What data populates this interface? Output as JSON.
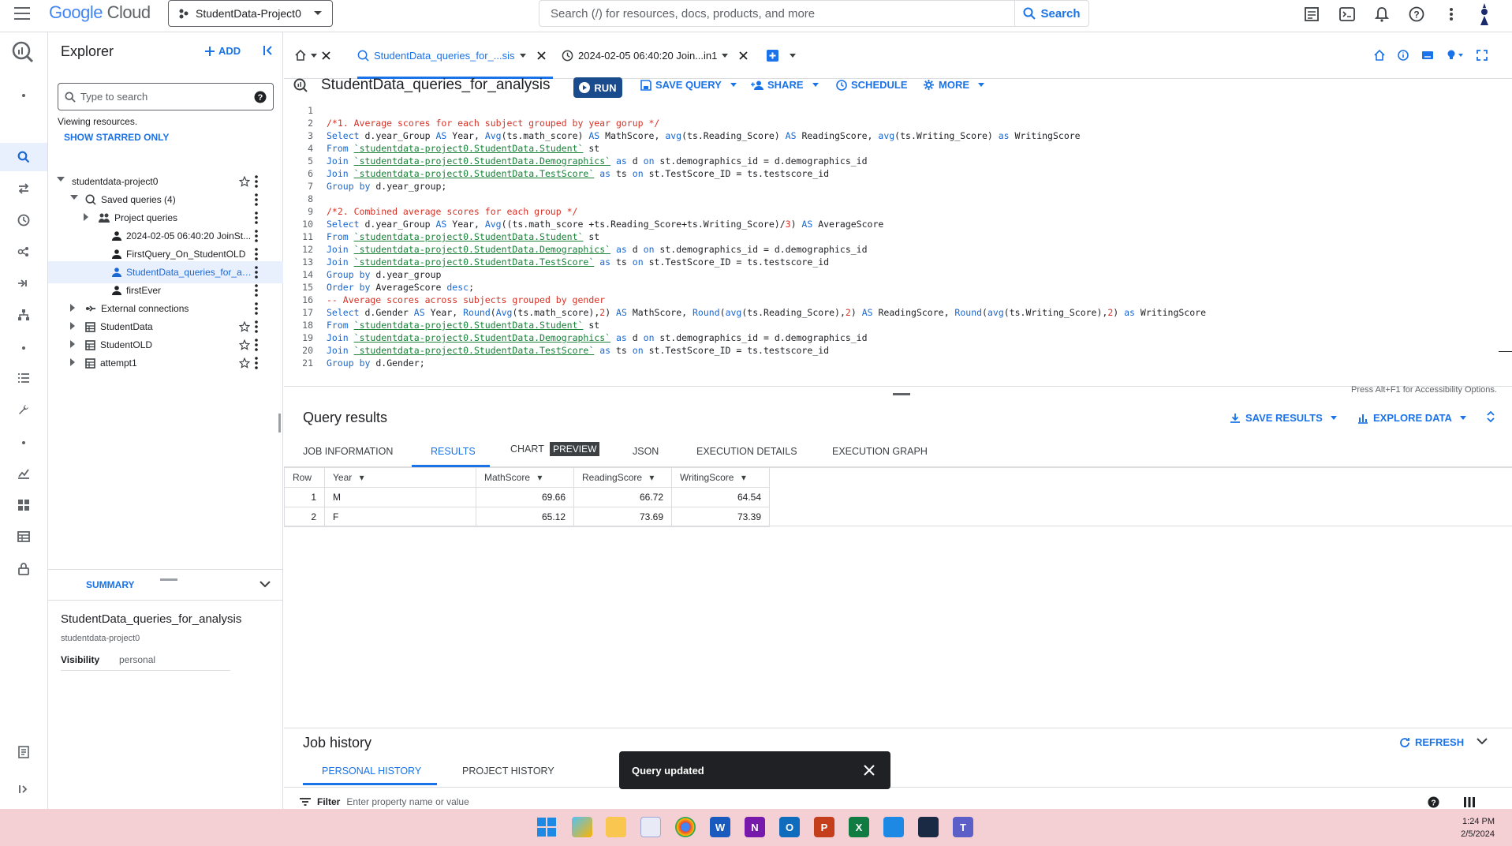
{
  "topbar": {
    "logo_google": "Google",
    "logo_cloud": "Cloud",
    "project": "StudentData-Project0",
    "search_placeholder": "Search (/) for resources, docs, products, and more",
    "search_button": "Search"
  },
  "explorer": {
    "title": "Explorer",
    "add_label": "ADD",
    "search_placeholder": "Type to search",
    "viewing": "Viewing resources.",
    "show_starred": "SHOW STARRED ONLY",
    "tree": [
      {
        "label": "studentdata-project0",
        "indent": 0,
        "expanded": true,
        "icon": "none",
        "star": true
      },
      {
        "label": "Saved queries (4)",
        "indent": 1,
        "expanded": true,
        "icon": "saved-query-icon",
        "star": false
      },
      {
        "label": "Project queries",
        "indent": 2,
        "expanded": false,
        "icon": "people-icon",
        "star": false
      },
      {
        "label": "2024-02-05 06:40:20 JoinSt...",
        "indent": 3,
        "icon": "person-icon",
        "star": false
      },
      {
        "label": "FirstQuery_On_StudentOLD",
        "indent": 3,
        "icon": "person-icon",
        "star": false
      },
      {
        "label": "StudentData_queries_for_an...",
        "indent": 3,
        "icon": "person-icon",
        "star": false,
        "selected": true
      },
      {
        "label": "firstEver",
        "indent": 3,
        "icon": "person-icon",
        "star": false
      },
      {
        "label": "External connections",
        "indent": 1,
        "expanded": false,
        "icon": "connection-icon",
        "star": false
      },
      {
        "label": "StudentData",
        "indent": 1,
        "expanded": false,
        "icon": "dataset-icon",
        "star": true
      },
      {
        "label": "StudentOLD",
        "indent": 1,
        "expanded": false,
        "icon": "dataset-icon",
        "star": true
      },
      {
        "label": "attempt1",
        "indent": 1,
        "expanded": false,
        "icon": "dataset-icon",
        "star": true
      }
    ],
    "summary_label": "SUMMARY",
    "summary_title": "StudentData_queries_for_analysis",
    "summary_project": "studentdata-project0",
    "visibility_label": "Visibility",
    "visibility_value": "personal"
  },
  "tabs": {
    "tab1": "StudentData_queries_for_...sis",
    "tab2": "2024-02-05 06:40:20 Join...in1"
  },
  "editor": {
    "title": "StudentData_queries_for_analysis",
    "run": "RUN",
    "save_query": "SAVE QUERY",
    "share": "SHARE",
    "schedule": "SCHEDULE",
    "more": "MORE",
    "a11y_hint": "Press Alt+F1 for Accessibility Options."
  },
  "code_lines": [
    "",
    "/*1. Average scores for each subject grouped by year gorup */",
    "Select d.year_Group AS Year, Avg(ts.math_score) AS MathScore, avg(ts.Reading_Score) AS ReadingScore, avg(ts.Writing_Score) as WritingScore",
    "From `studentdata-project0.StudentData.Student` st",
    "Join `studentdata-project0.StudentData.Demographics` as d on st.demographics_id = d.demographics_id",
    "Join `studentdata-project0.StudentData.TestScore` as ts on st.TestScore_ID = ts.testscore_id",
    "Group by d.year_group;",
    "",
    "/*2. Combined average scores for each group */",
    "Select d.year_Group AS Year, Avg((ts.math_score +ts.Reading_Score+ts.Writing_Score)/3) AS AverageScore",
    "From `studentdata-project0.StudentData.Student` st",
    "Join `studentdata-project0.StudentData.Demographics` as d on st.demographics_id = d.demographics_id",
    "Join `studentdata-project0.StudentData.TestScore` as ts on st.TestScore_ID = ts.testscore_id",
    "Group by d.year_group",
    "Order by AverageScore desc;",
    "-- Average scores across subjects grouped by gender",
    "Select d.Gender AS Year, Round(Avg(ts.math_score),2) AS MathScore, Round(avg(ts.Reading_Score),2) AS ReadingScore, Round(avg(ts.Writing_Score),2) as WritingScore",
    "From `studentdata-project0.StudentData.Student` st",
    "Join `studentdata-project0.StudentData.Demographics` as d on st.demographics_id = d.demographics_id",
    "Join `studentdata-project0.StudentData.TestScore` as ts on st.TestScore_ID = ts.testscore_id",
    "Group by d.Gender;"
  ],
  "results": {
    "title": "Query results",
    "save_results": "SAVE RESULTS",
    "explore_data": "EXPLORE DATA",
    "tabs": [
      "JOB INFORMATION",
      "RESULTS",
      "CHART",
      "JSON",
      "EXECUTION DETAILS",
      "EXECUTION GRAPH"
    ],
    "preview_badge": "PREVIEW",
    "columns": [
      "Row",
      "Year",
      "MathScore",
      "ReadingScore",
      "WritingScore"
    ],
    "rows": [
      [
        "1",
        "M",
        "69.66",
        "66.72",
        "64.54"
      ],
      [
        "2",
        "F",
        "65.12",
        "73.69",
        "73.39"
      ]
    ]
  },
  "job_history": {
    "title": "Job history",
    "refresh": "REFRESH",
    "personal": "PERSONAL HISTORY",
    "project": "PROJECT HISTORY",
    "filter_label": "Filter",
    "filter_placeholder": "Enter property name or value"
  },
  "toast": {
    "message": "Query updated"
  },
  "taskbar": {
    "time": "1:24 PM",
    "date": "2/5/2024"
  }
}
